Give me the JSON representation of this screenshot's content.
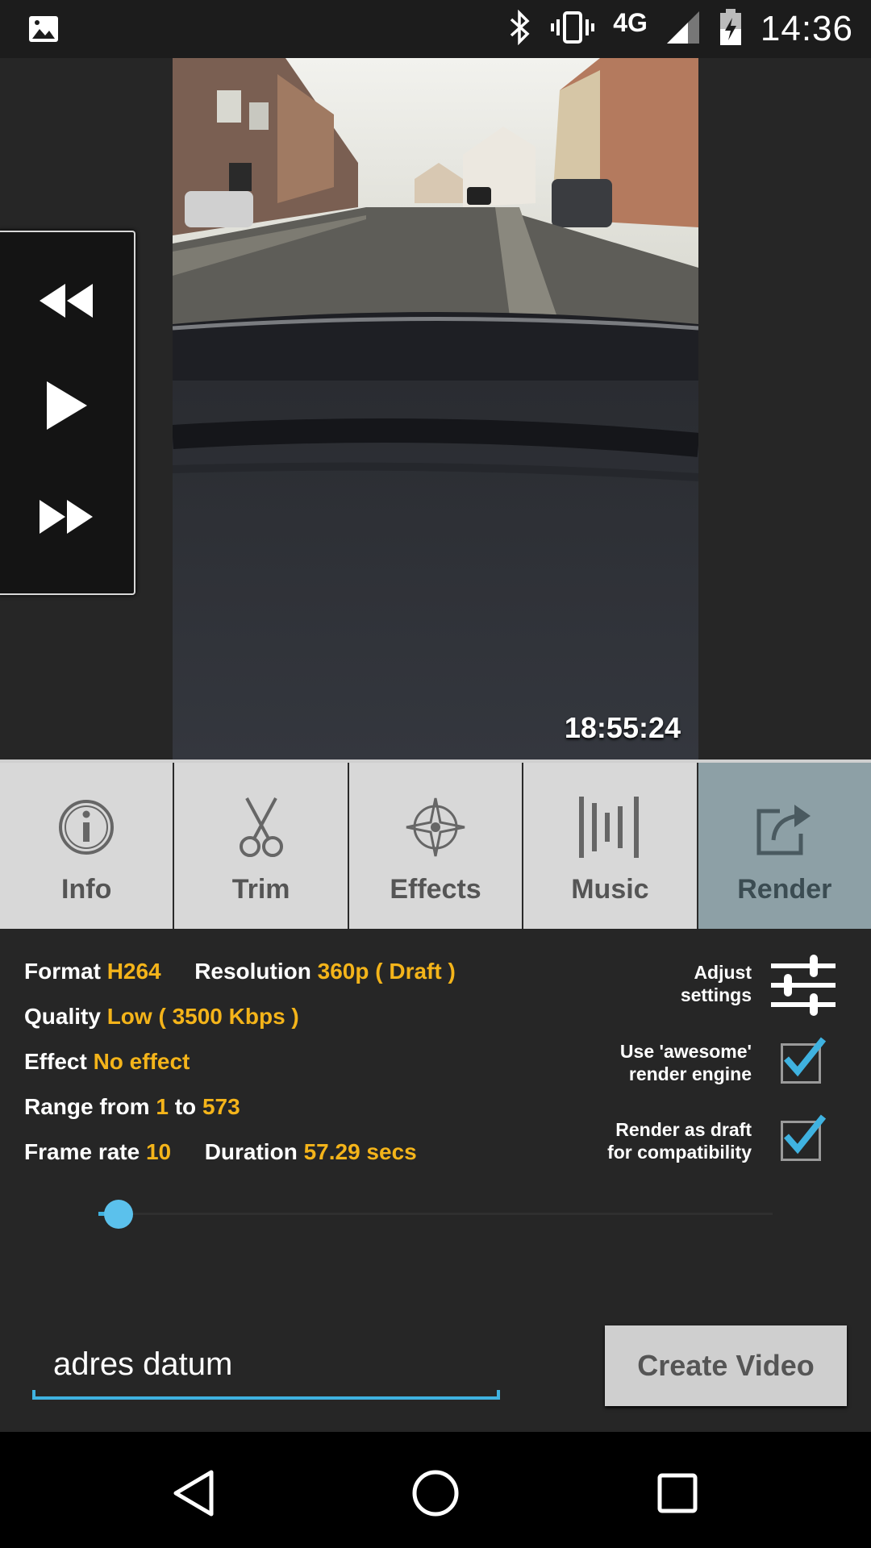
{
  "status_bar": {
    "network": "4G",
    "time": "14:36",
    "icons": [
      "image-icon",
      "bluetooth-icon",
      "vibrate-icon",
      "signal-icon",
      "battery-charging-icon"
    ]
  },
  "video": {
    "timestamp": "18:55:24"
  },
  "playback_controls": {
    "icons": [
      "rewind-icon",
      "play-icon",
      "fast-forward-icon"
    ]
  },
  "tabs": [
    {
      "label": "Info",
      "icon": "info-icon",
      "active": false
    },
    {
      "label": "Trim",
      "icon": "scissors-icon",
      "active": false
    },
    {
      "label": "Effects",
      "icon": "effects-icon",
      "active": false
    },
    {
      "label": "Music",
      "icon": "music-bars-icon",
      "active": false
    },
    {
      "label": "Render",
      "icon": "share-icon",
      "active": true
    }
  ],
  "render_info": {
    "format_label": "Format",
    "format_value": "H264",
    "resolution_label": "Resolution",
    "resolution_value": "360p ( Draft )",
    "quality_label": "Quality",
    "quality_value": "Low ( 3500 Kbps )",
    "effect_label": "Effect",
    "effect_value": "No effect",
    "range_label": "Range from",
    "range_from": "1",
    "range_to_label": "to",
    "range_to": "573",
    "framerate_label": "Frame rate",
    "framerate_value": "10",
    "duration_label": "Duration",
    "duration_value": "57.29 secs"
  },
  "options": {
    "adjust_line1": "Adjust",
    "adjust_line2": "settings",
    "awesome_line1": "Use 'awesome'",
    "awesome_line2": "render engine",
    "awesome_checked": true,
    "draft_line1": "Render as draft",
    "draft_line2": "for compatibility",
    "draft_checked": true
  },
  "seek": {
    "position_fraction": 0.03
  },
  "name_input": {
    "value": "adres datum"
  },
  "create_button": {
    "label": "Create Video"
  },
  "colors": {
    "accent": "#3fb2e0",
    "value_yellow": "#f4b41a",
    "active_tab": "#8da0a6"
  }
}
